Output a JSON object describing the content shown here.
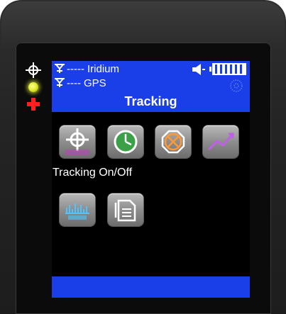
{
  "status": {
    "iridium_dashes": "-----",
    "iridium_label": "Iridium",
    "gps_dashes": "----",
    "gps_label": "GPS",
    "battery_icon": "battery-full-icon",
    "speaker_icon": "speaker-icon",
    "satellite_icon": "satellite-icon"
  },
  "title": "Tracking",
  "menu": {
    "items": [
      {
        "icon": "tracking-on-off-icon"
      },
      {
        "icon": "clock-icon"
      },
      {
        "icon": "stop-icon"
      },
      {
        "icon": "chart-icon"
      },
      {
        "icon": "ruler-icon"
      },
      {
        "icon": "document-icon"
      }
    ],
    "selected_label": "Tracking On/Off"
  },
  "indicators": {
    "target_icon": "crosshair-icon",
    "led_color": "#e4f02c",
    "sos_icon": "plus-icon"
  },
  "colors": {
    "bar_blue": "#1a3fe8",
    "screen_bg": "#000000"
  }
}
